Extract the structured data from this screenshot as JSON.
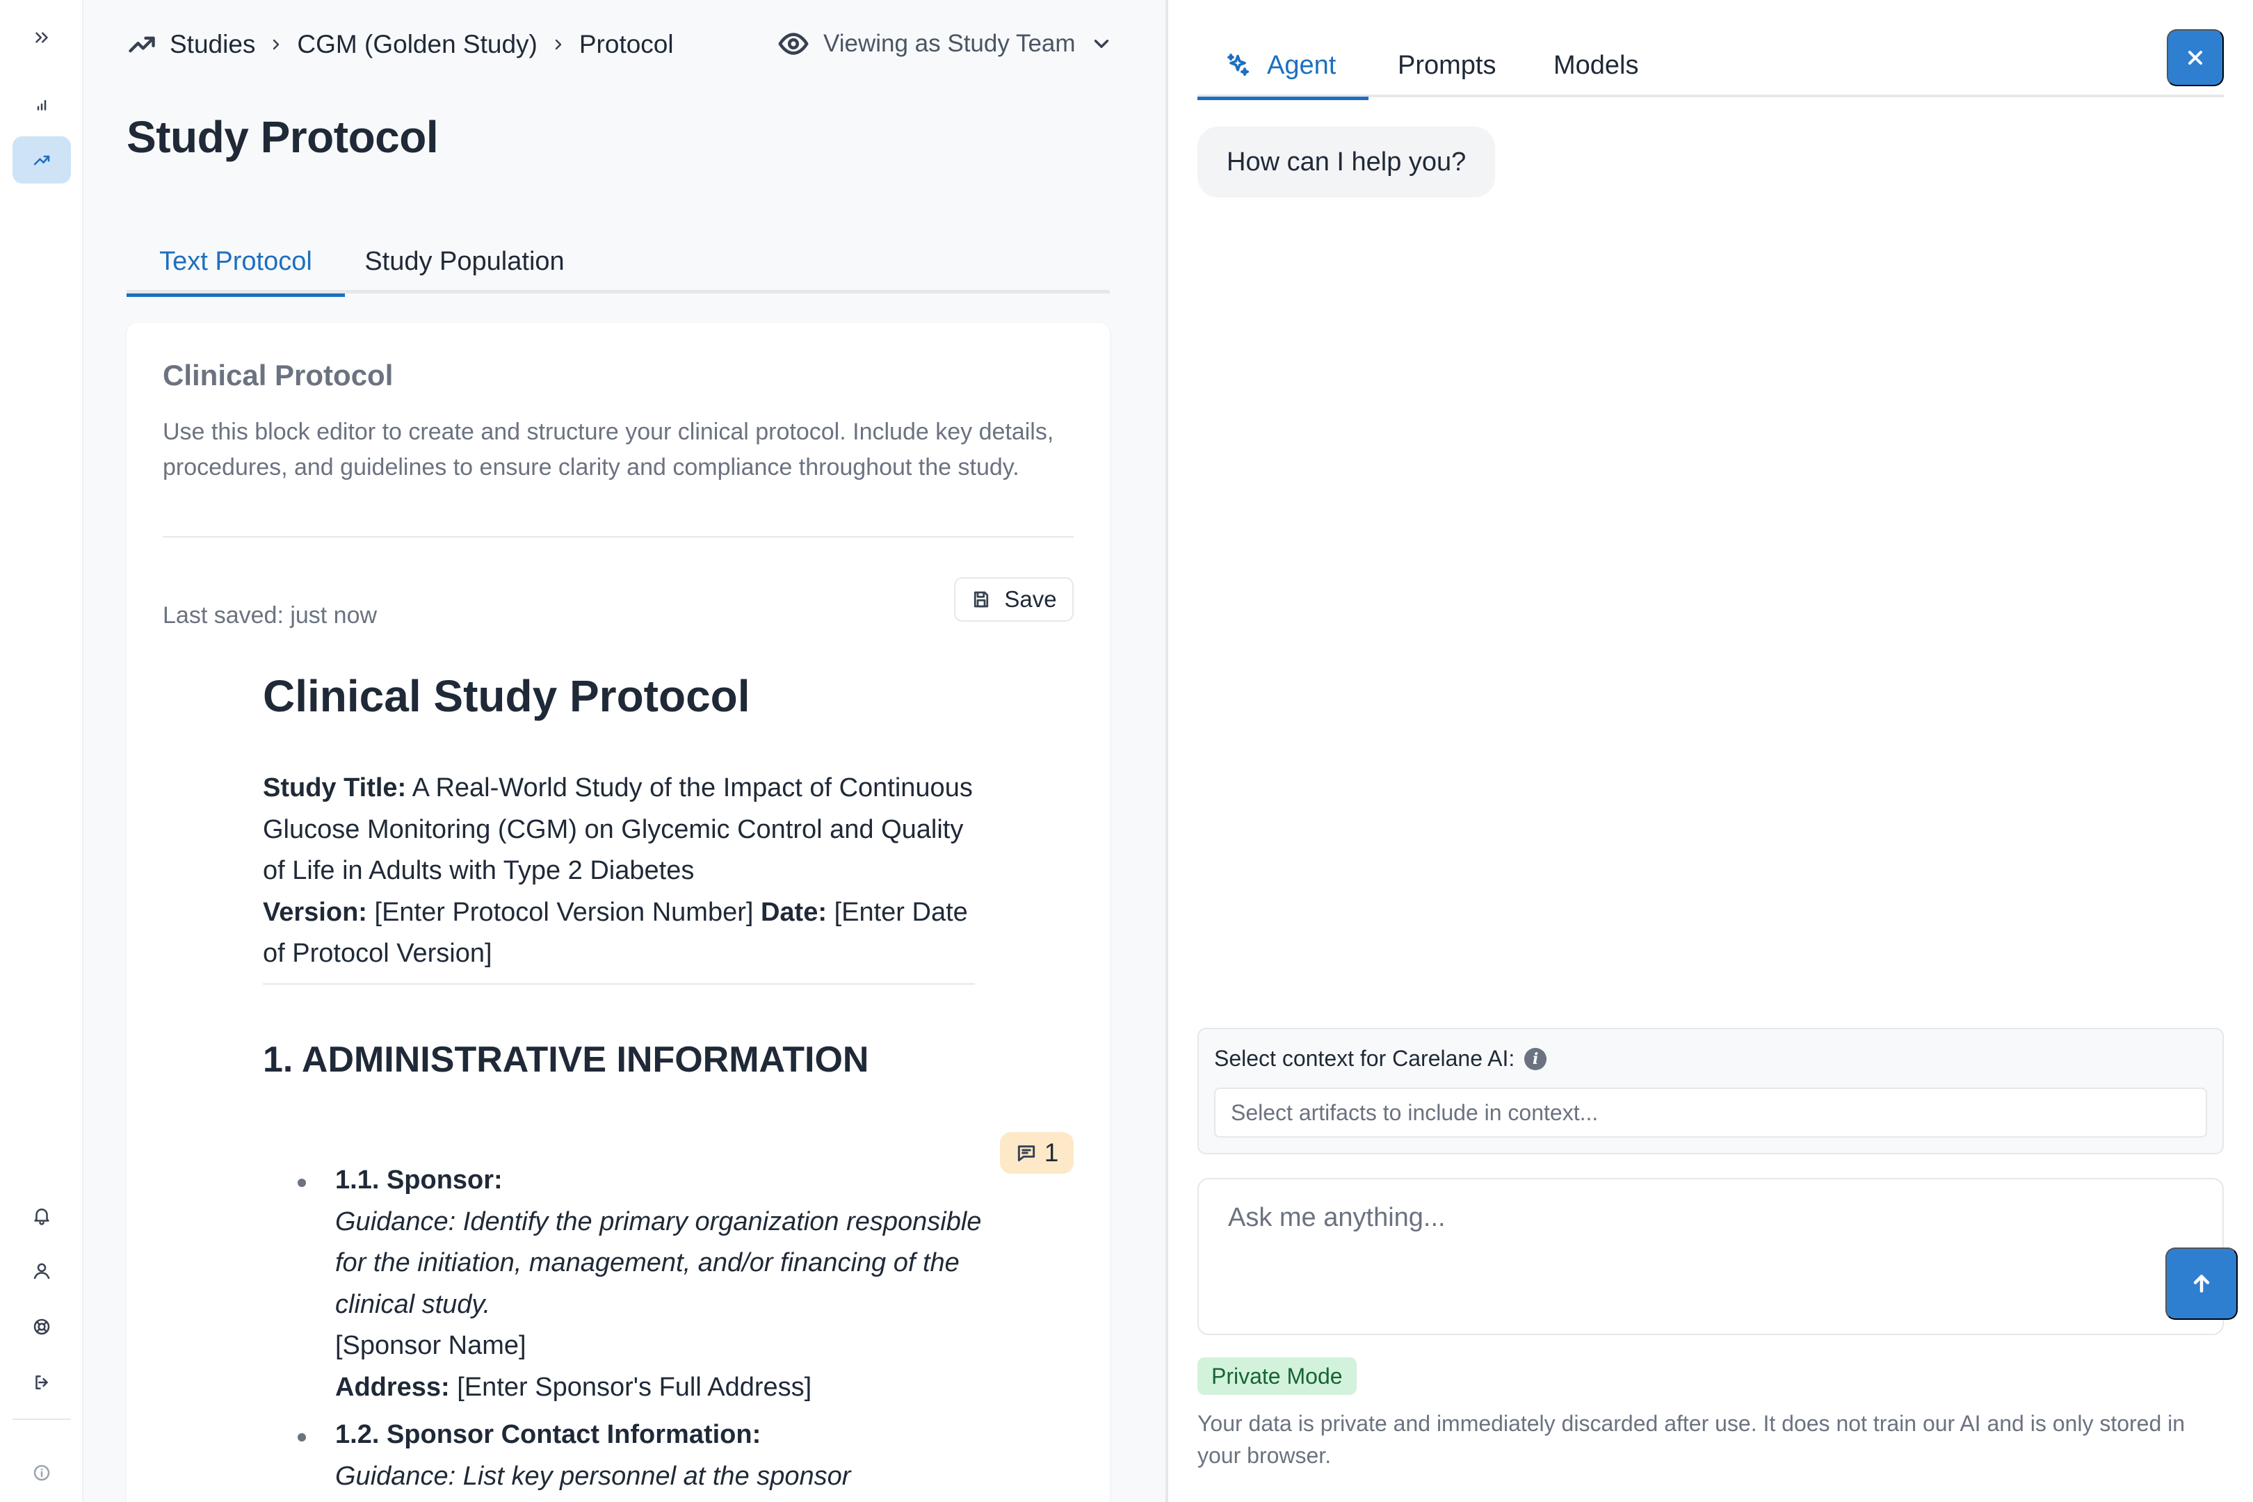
{
  "rail": {
    "items": [
      {
        "name": "expand-icon"
      },
      {
        "name": "bar-chart-icon"
      },
      {
        "name": "trending-up-icon",
        "active": true
      },
      {
        "name": "bell-icon"
      },
      {
        "name": "user-icon"
      },
      {
        "name": "lifebuoy-icon"
      },
      {
        "name": "logout-icon"
      },
      {
        "name": "info-icon"
      }
    ]
  },
  "breadcrumb": {
    "items": [
      "Studies",
      "CGM (Golden Study)",
      "Protocol"
    ],
    "icon": "trending-up-icon"
  },
  "view_as": {
    "label": "Viewing as Study Team",
    "icon": "eye-icon"
  },
  "page": {
    "title": "Study Protocol",
    "tabs": [
      {
        "label": "Text Protocol",
        "active": true
      },
      {
        "label": "Study Population",
        "active": false
      }
    ]
  },
  "card": {
    "title": "Clinical Protocol",
    "description": "Use this block editor to create and structure your clinical protocol. Include key details, procedures, and guidelines to ensure clarity and compliance throughout the study.",
    "last_saved": "Last saved: just now",
    "save_label": "Save"
  },
  "document": {
    "title": "Clinical Study Protocol",
    "study_title_label": "Study Title:",
    "study_title_value": " A Real-World Study of the Impact of Continuous Glucose Monitoring (CGM) on Glycemic Control and Quality of Life in Adults with Type 2 Diabetes",
    "version_label": "Version:",
    "version_value": " [Enter Protocol Version Number] ",
    "date_label": "Date:",
    "date_value": " [Enter Date of Protocol Version]",
    "section_heading": "1. ADMINISTRATIVE INFORMATION",
    "comment_count": "1",
    "items": [
      {
        "label": "1.1. Sponsor:",
        "guidance": "Guidance: Identify the primary organization responsible for the initiation, management, and/or financing of the clinical study.",
        "placeholder": "[Sponsor Name]",
        "address_label": "Address:",
        "address_value": " [Enter Sponsor's Full Address]"
      },
      {
        "label": "1.2. Sponsor Contact Information:",
        "guidance": "Guidance: List key personnel at the sponsor"
      }
    ]
  },
  "panel": {
    "tabs": [
      {
        "label": "Agent",
        "active": true,
        "icon": "sparkles-icon"
      },
      {
        "label": "Prompts",
        "active": false
      },
      {
        "label": "Models",
        "active": false
      }
    ],
    "greeting": "How can I help you?",
    "context_label": "Select context for Carelane AI:",
    "context_placeholder": "Select artifacts to include in context...",
    "ask_placeholder": "Ask me anything...",
    "private_badge": "Private Mode",
    "private_text": "Your data is private and immediately discarded after use. It does not train our AI and is only stored in your browser."
  },
  "colors": {
    "accent": "#1d6fbf",
    "button_blue": "#2f7fd1",
    "active_rail_bg": "#cfe3f7",
    "comment_badge_bg": "#fde9c8",
    "private_badge_bg": "#d3f2dc"
  }
}
